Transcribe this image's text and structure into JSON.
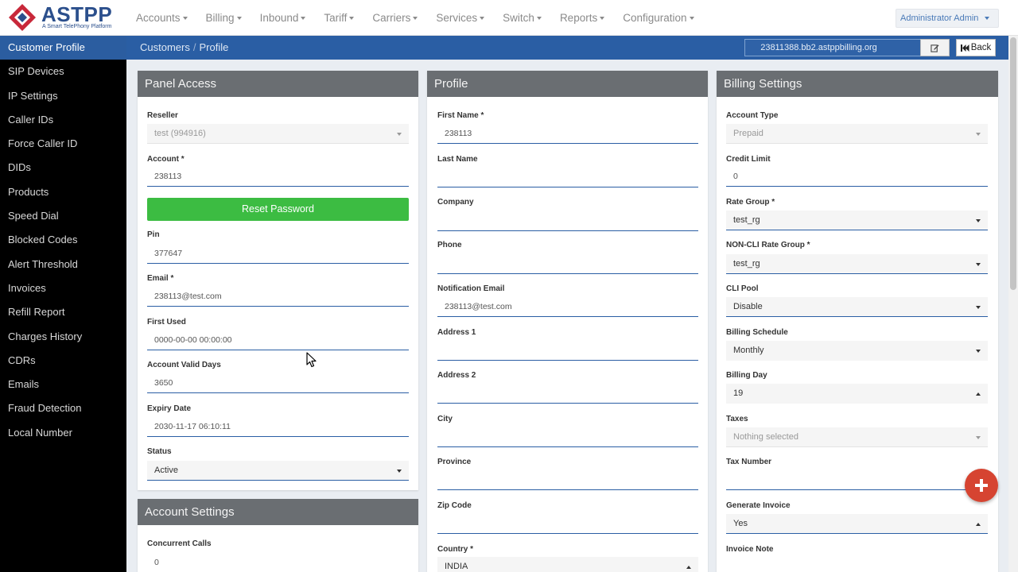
{
  "brand": {
    "name": "ASTPP",
    "tagline": "A Smart TelePhony Platform"
  },
  "nav": [
    "Accounts",
    "Billing",
    "Inbound",
    "Tariff",
    "Carriers",
    "Services",
    "Switch",
    "Reports",
    "Configuration"
  ],
  "user_menu": "Administrator Admin",
  "sidebar": [
    "Customer Profile",
    "SIP Devices",
    "IP Settings",
    "Caller IDs",
    "Force Caller ID",
    "DIDs",
    "Products",
    "Speed Dial",
    "Blocked Codes",
    "Alert Threshold",
    "Invoices",
    "Refill Report",
    "Charges History",
    "CDRs",
    "Emails",
    "Fraud Detection",
    "Local Number"
  ],
  "breadcrumb": {
    "parent": "Customers",
    "current": "Profile"
  },
  "domain": "23811388.bb2.astppbilling.org",
  "back_label": "Back",
  "panel_access": {
    "title": "Panel Access",
    "reseller_label": "Reseller",
    "reseller_value": "test (994916)",
    "account_label": "Account *",
    "account_value": "238113",
    "reset_label": "Reset Password",
    "pin_label": "Pin",
    "pin_value": "377647",
    "email_label": "Email *",
    "email_value": "238113@test.com",
    "first_used_label": "First Used",
    "first_used_value": "0000-00-00 00:00:00",
    "valid_days_label": "Account Valid Days",
    "valid_days_value": "3650",
    "expiry_label": "Expiry Date",
    "expiry_value": "2030-11-17 06:10:11",
    "status_label": "Status",
    "status_value": "Active"
  },
  "account_settings": {
    "title": "Account Settings",
    "concurrent_label": "Concurrent Calls",
    "concurrent_value": "0"
  },
  "profile": {
    "title": "Profile",
    "first_name_label": "First Name *",
    "first_name_value": "238113",
    "last_name_label": "Last Name",
    "last_name_value": "",
    "company_label": "Company",
    "company_value": "",
    "phone_label": "Phone",
    "phone_value": "",
    "notif_email_label": "Notification Email",
    "notif_email_value": "238113@test.com",
    "address1_label": "Address 1",
    "address1_value": "",
    "address2_label": "Address 2",
    "address2_value": "",
    "city_label": "City",
    "city_value": "",
    "province_label": "Province",
    "province_value": "",
    "zip_label": "Zip Code",
    "zip_value": "",
    "country_label": "Country *",
    "country_value": "INDIA"
  },
  "billing": {
    "title": "Billing Settings",
    "account_type_label": "Account Type",
    "account_type_value": "Prepaid",
    "credit_limit_label": "Credit Limit",
    "credit_limit_value": "0",
    "rate_group_label": "Rate Group *",
    "rate_group_value": "test_rg",
    "noncli_label": "NON-CLI Rate Group *",
    "noncli_value": "test_rg",
    "cli_pool_label": "CLI Pool",
    "cli_pool_value": "Disable",
    "schedule_label": "Billing Schedule",
    "schedule_value": "Monthly",
    "billing_day_label": "Billing Day",
    "billing_day_value": "19",
    "taxes_label": "Taxes",
    "taxes_value": "Nothing selected",
    "tax_number_label": "Tax Number",
    "tax_number_value": "",
    "gen_invoice_label": "Generate Invoice",
    "gen_invoice_value": "Yes",
    "invoice_note_label": "Invoice Note"
  },
  "colors": {
    "nav_blue": "#2a5ea4",
    "panel_head": "#6a6e72",
    "reset_green": "#3cbc42",
    "fab_red": "#d64431"
  },
  "icons": [
    "astpp-logo-icon",
    "edit-icon",
    "back-icon",
    "plus-icon",
    "mouse-cursor-icon"
  ]
}
